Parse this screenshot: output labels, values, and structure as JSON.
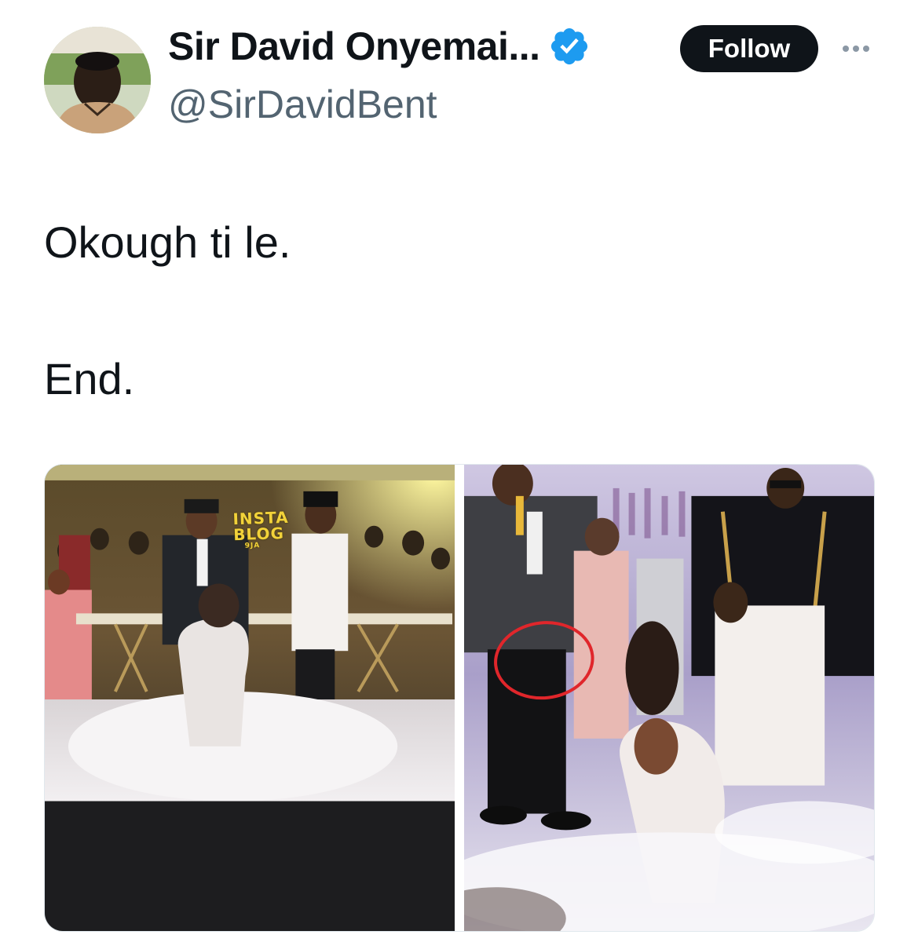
{
  "author": {
    "display_name": "Sir David Onyemai...",
    "handle": "@SirDavidBent",
    "verified": true
  },
  "actions": {
    "follow_label": "Follow",
    "more_icon": "ellipsis-icon"
  },
  "tweet": {
    "lines": [
      "Okough ti le.",
      "End."
    ]
  },
  "media": {
    "photos": [
      {
        "watermark": [
          "INSTA",
          "BLOG",
          "9JA"
        ]
      },
      {
        "annotation": "red-circle"
      }
    ]
  },
  "colors": {
    "text_primary": "#0f1419",
    "text_secondary": "#536471",
    "follow_bg": "#0f1419",
    "verified_blue": "#1d9bf0",
    "annotation_red": "#e0262b"
  }
}
